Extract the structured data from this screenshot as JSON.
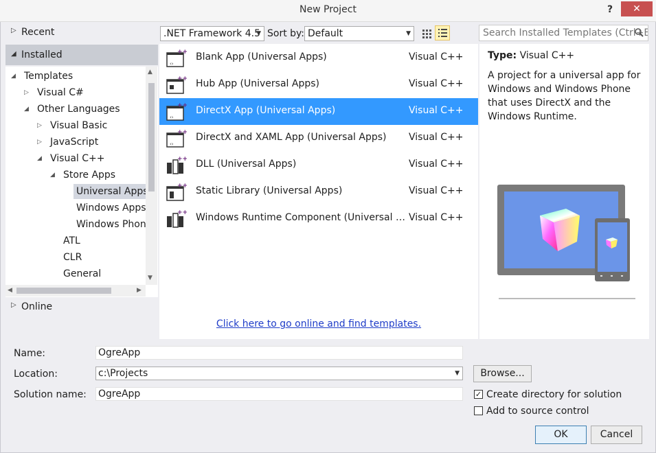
{
  "window": {
    "title": "New Project",
    "help_label": "?",
    "close_label": "✕"
  },
  "left_nav": {
    "recent": "Recent",
    "installed": "Installed",
    "online": "Online",
    "tree": [
      {
        "label": "Templates",
        "indent": 0,
        "expander": "down"
      },
      {
        "label": "Visual C#",
        "indent": 1,
        "expander": "right"
      },
      {
        "label": "Other Languages",
        "indent": 1,
        "expander": "down"
      },
      {
        "label": "Visual Basic",
        "indent": 2,
        "expander": "right"
      },
      {
        "label": "JavaScript",
        "indent": 2,
        "expander": "right"
      },
      {
        "label": "Visual C++",
        "indent": 2,
        "expander": "down"
      },
      {
        "label": "Store Apps",
        "indent": 3,
        "expander": "down"
      },
      {
        "label": "Universal Apps",
        "indent": 4,
        "expander": "none",
        "selected": true
      },
      {
        "label": "Windows Apps",
        "indent": 4,
        "expander": "none"
      },
      {
        "label": "Windows Phone Apps",
        "indent": 4,
        "expander": "none"
      },
      {
        "label": "ATL",
        "indent": 3,
        "expander": "none"
      },
      {
        "label": "CLR",
        "indent": 3,
        "expander": "none"
      },
      {
        "label": "General",
        "indent": 3,
        "expander": "none"
      }
    ]
  },
  "toolbar": {
    "framework": ".NET Framework 4.5",
    "sort_label": "Sort by:",
    "sort_value": "Default",
    "search_placeholder": "Search Installed Templates (Ctrl+E)"
  },
  "templates": [
    {
      "name": "Blank App (Universal Apps)",
      "lang": "Visual C++",
      "icon": "blank-app-icon"
    },
    {
      "name": "Hub App (Universal Apps)",
      "lang": "Visual C++",
      "icon": "hub-app-icon"
    },
    {
      "name": "DirectX App (Universal Apps)",
      "lang": "Visual C++",
      "icon": "directx-app-icon",
      "selected": true
    },
    {
      "name": "DirectX and XAML App (Universal Apps)",
      "lang": "Visual C++",
      "icon": "directx-xaml-app-icon"
    },
    {
      "name": "DLL (Universal Apps)",
      "lang": "Visual C++",
      "icon": "dll-icon"
    },
    {
      "name": "Static Library (Universal Apps)",
      "lang": "Visual C++",
      "icon": "static-library-icon"
    },
    {
      "name": "Windows Runtime Component (Universal Apps)",
      "lang": "Visual C++",
      "icon": "runtime-component-icon"
    }
  ],
  "online_link": "Click here to go online and find templates.",
  "details": {
    "type_label": "Type:",
    "type_value": "Visual C++",
    "description": "A project for a universal app for Windows and Windows Phone that uses DirectX and the Windows Runtime."
  },
  "form": {
    "name_label": "Name:",
    "name_value": "OgreApp",
    "location_label": "Location:",
    "location_value": "c:\\Projects",
    "solution_label": "Solution name:",
    "solution_value": "OgreApp",
    "browse_label": "Browse...",
    "create_dir_label": "Create directory for solution",
    "create_dir_checked": true,
    "source_control_label": "Add to source control",
    "source_control_checked": false,
    "ok_label": "OK",
    "cancel_label": "Cancel"
  },
  "colors": {
    "selection": "#3399ff",
    "accent_icon": "#68217a",
    "close_button": "#c75050"
  }
}
